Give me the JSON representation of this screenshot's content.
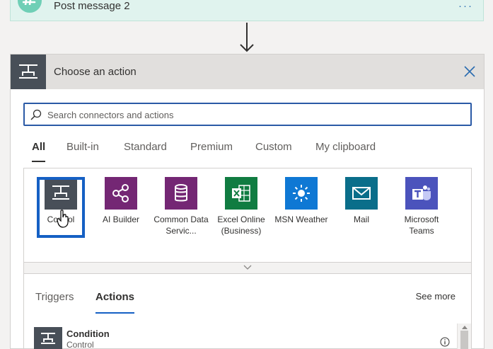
{
  "prev_step": {
    "title": "Post message 2",
    "menu": "···",
    "icon": "slack-icon"
  },
  "action_card": {
    "title": "Choose an action",
    "icon": "control-icon",
    "close_icon": "close-icon",
    "search": {
      "placeholder": "Search connectors and actions",
      "value": ""
    },
    "tabs": [
      {
        "label": "All",
        "active": true
      },
      {
        "label": "Built-in",
        "active": false
      },
      {
        "label": "Standard",
        "active": false
      },
      {
        "label": "Premium",
        "active": false
      },
      {
        "label": "Custom",
        "active": false
      },
      {
        "label": "My clipboard",
        "active": false
      }
    ],
    "connectors": [
      {
        "name": "Control",
        "color": "#484f58",
        "icon": "control-icon",
        "selected": true
      },
      {
        "name": "AI Builder",
        "color": "#742774",
        "icon": "ai-builder-icon"
      },
      {
        "name": "Common Data Servic...",
        "color": "#742774",
        "icon": "database-icon"
      },
      {
        "name": "Excel Online (Business)",
        "color": "#107c41",
        "icon": "excel-icon"
      },
      {
        "name": "MSN Weather",
        "color": "#0f78d4",
        "icon": "sun-icon"
      },
      {
        "name": "Mail",
        "color": "#0a6e8a",
        "icon": "mail-icon"
      },
      {
        "name": "Microsoft Teams",
        "color": "#4b53bc",
        "icon": "teams-icon"
      }
    ],
    "sub_tabs": [
      {
        "label": "Triggers",
        "active": false
      },
      {
        "label": "Actions",
        "active": true
      }
    ],
    "see_more": "See more",
    "actions": [
      {
        "name": "Condition",
        "connector": "Control"
      }
    ]
  }
}
